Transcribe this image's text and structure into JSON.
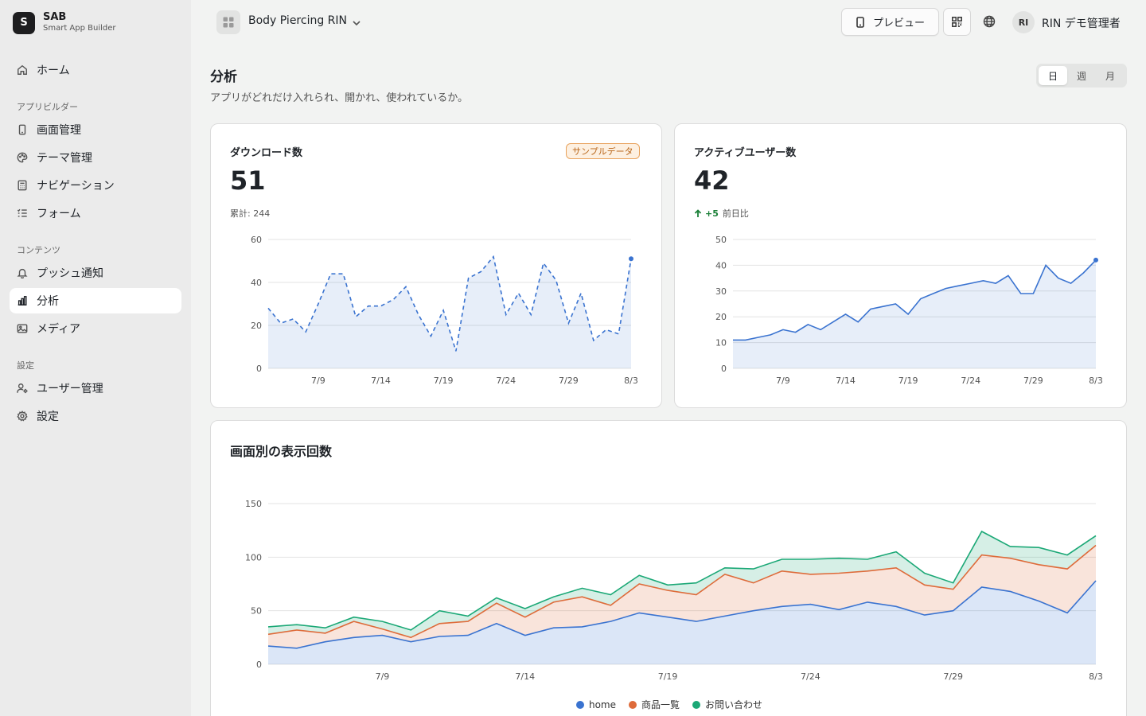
{
  "brand": {
    "logo_letter": "S",
    "name": "SAB",
    "subtitle": "Smart App Builder"
  },
  "sidebar": {
    "home": {
      "label": "ホーム",
      "icon": "home-icon"
    },
    "sections": [
      "アプリビルダー",
      "コンテンツ",
      "設定"
    ],
    "app_builder": [
      {
        "label": "画面管理",
        "icon": "phone-icon"
      },
      {
        "label": "テーマ管理",
        "icon": "palette-icon"
      },
      {
        "label": "ナビゲーション",
        "icon": "calculator-icon"
      },
      {
        "label": "フォーム",
        "icon": "list-check-icon"
      }
    ],
    "content": [
      {
        "label": "プッシュ通知",
        "icon": "bell-icon"
      },
      {
        "label": "分析",
        "icon": "bar-chart-icon",
        "active": true
      },
      {
        "label": "メディア",
        "icon": "image-icon"
      }
    ],
    "settings": [
      {
        "label": "ユーザー管理",
        "icon": "user-cog-icon"
      },
      {
        "label": "設定",
        "icon": "gear-icon"
      }
    ]
  },
  "header": {
    "project_name": "Body Piercing RIN",
    "preview_label": "プレビュー",
    "avatar_initials": "RI",
    "user_name": "RIN デモ管理者"
  },
  "page": {
    "title": "分析",
    "description": "アプリがどれだけ入れられ、開かれ、使われているか。",
    "range_options": [
      "日",
      "週",
      "月"
    ],
    "range_selected": "日"
  },
  "downloads": {
    "title": "ダウンロード数",
    "badge": "サンプルデータ",
    "value": "51",
    "sub": "累計: 244"
  },
  "active_users": {
    "title": "アクティブユーザー数",
    "value": "42",
    "delta": "+5",
    "delta_label": "前日比"
  },
  "screen_views": {
    "title": "画面別の表示回数"
  },
  "colors": {
    "blue": "#3a73d0",
    "orange": "#de6b3a",
    "green": "#1ba876"
  },
  "chart_data": [
    {
      "type": "area",
      "name": "downloads",
      "x_ticks": [
        "7/9",
        "7/14",
        "7/19",
        "7/24",
        "7/29",
        "8/3"
      ],
      "x_tick_index": [
        5,
        10,
        15,
        20,
        25,
        30
      ],
      "y_ticks": [
        0,
        20,
        40,
        60
      ],
      "ylim": [
        0,
        60
      ],
      "line_style": "dashed",
      "values": [
        28,
        21,
        23,
        17,
        30,
        44,
        44,
        24,
        29,
        29,
        32,
        38,
        25,
        15,
        27,
        8,
        42,
        45,
        52,
        25,
        35,
        25,
        49,
        41,
        21,
        35,
        13,
        18,
        16,
        51
      ]
    },
    {
      "type": "area",
      "name": "active_users",
      "x_ticks": [
        "7/9",
        "7/14",
        "7/19",
        "7/24",
        "7/29",
        "8/3"
      ],
      "x_tick_index": [
        5,
        10,
        15,
        20,
        25,
        30
      ],
      "y_ticks": [
        0,
        10,
        20,
        30,
        40,
        50
      ],
      "ylim": [
        0,
        50
      ],
      "line_style": "solid",
      "values": [
        11,
        11,
        12,
        13,
        15,
        14,
        17,
        15,
        18,
        21,
        18,
        23,
        24,
        25,
        21,
        27,
        29,
        31,
        32,
        33,
        34,
        33,
        36,
        29,
        29,
        40,
        35,
        33,
        37,
        42
      ]
    },
    {
      "type": "area",
      "stacked": true,
      "name": "screen_views",
      "x_ticks": [
        "7/9",
        "7/14",
        "7/19",
        "7/24",
        "7/29",
        "8/3"
      ],
      "x_tick_index": [
        5,
        10,
        15,
        20,
        25,
        30
      ],
      "y_ticks": [
        0,
        50,
        100,
        150
      ],
      "ylim": [
        0,
        150
      ],
      "series": [
        {
          "name": "home",
          "values": [
            17,
            15,
            21,
            25,
            27,
            21,
            26,
            27,
            38,
            27,
            34,
            35,
            40,
            48,
            44,
            40,
            45,
            50,
            54,
            56,
            51,
            58,
            54,
            46,
            50,
            72,
            68,
            59,
            48,
            78
          ]
        },
        {
          "name": "商品一覧",
          "values": [
            11,
            17,
            8,
            15,
            6,
            4,
            12,
            13,
            19,
            17,
            24,
            28,
            15,
            27,
            25,
            25,
            39,
            26,
            33,
            28,
            34,
            29,
            36,
            28,
            20,
            30,
            31,
            34,
            41,
            33
          ]
        },
        {
          "name": "お問い合わせ",
          "values": [
            7,
            5,
            5,
            4,
            7,
            7,
            12,
            5,
            5,
            8,
            5,
            8,
            10,
            8,
            5,
            11,
            6,
            13,
            11,
            14,
            14,
            11,
            15,
            11,
            6,
            22,
            11,
            16,
            13,
            9
          ]
        }
      ]
    }
  ]
}
